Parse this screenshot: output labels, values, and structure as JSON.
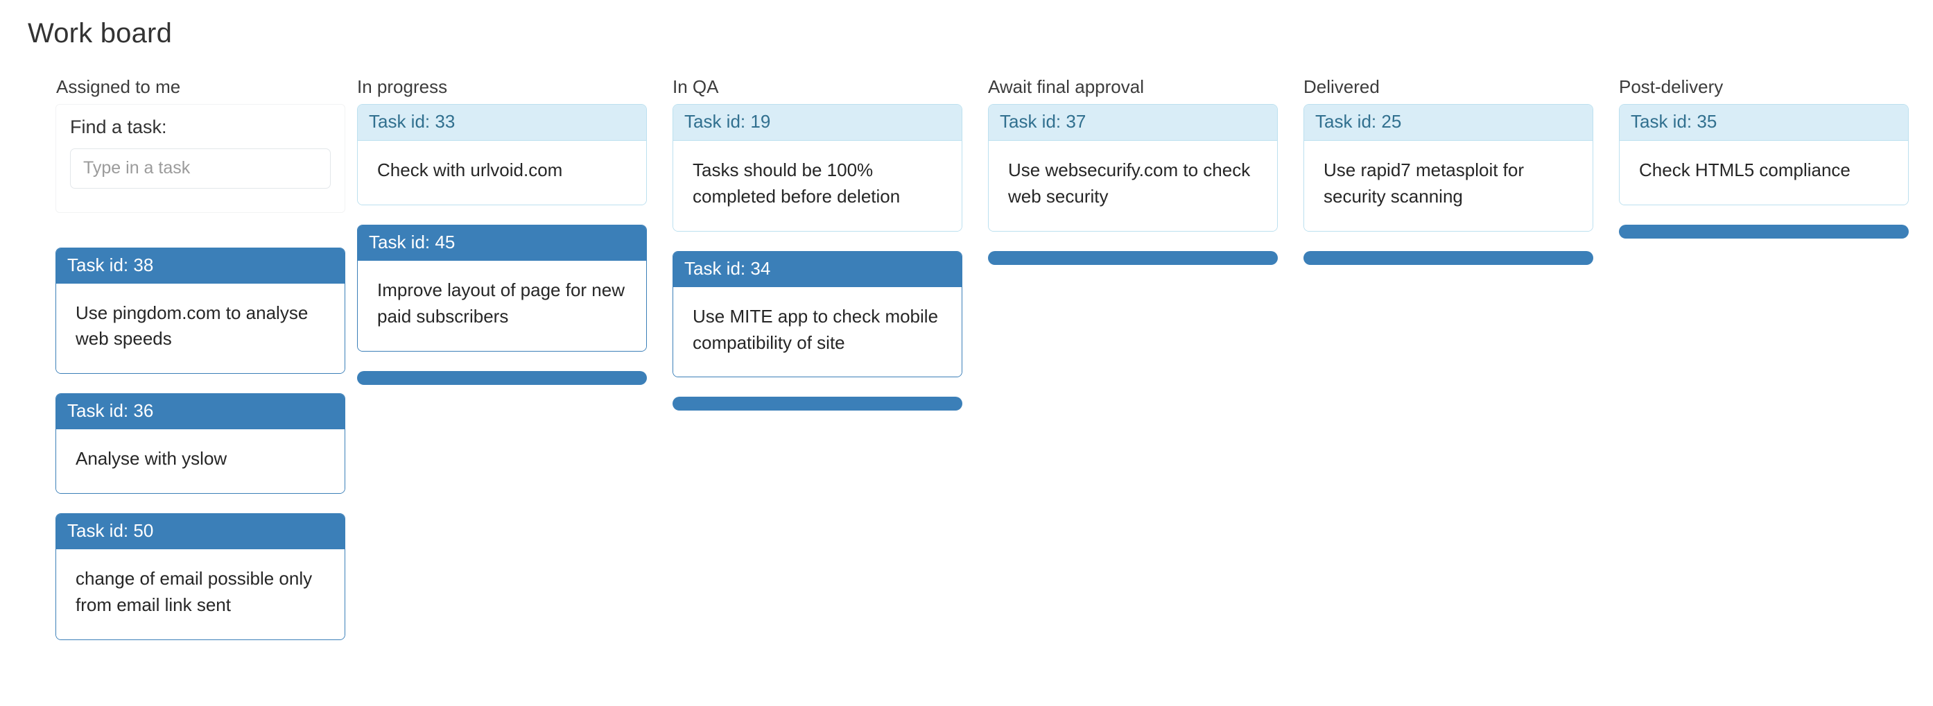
{
  "header": {
    "title": "Work board"
  },
  "search": {
    "label": "Find a task:",
    "placeholder": "Type in a task",
    "value": ""
  },
  "columns": [
    {
      "id": "assigned-to-me",
      "title": "Assigned to me",
      "has_search": true,
      "has_drop_bar": false,
      "cards": [
        {
          "id_label": "Task id: 38",
          "text": "Use pingdom.com to analyse web speeds",
          "style": "primary"
        },
        {
          "id_label": "Task id: 36",
          "text": "Analyse with yslow",
          "style": "primary"
        },
        {
          "id_label": "Task id: 50",
          "text": "change of email possible only from email link sent",
          "style": "primary"
        }
      ]
    },
    {
      "id": "in-progress",
      "title": "In progress",
      "has_search": false,
      "has_drop_bar": true,
      "cards": [
        {
          "id_label": "Task id: 33",
          "text": "Check with urlvoid.com",
          "style": "info"
        },
        {
          "id_label": "Task id: 45",
          "text": "Improve layout of page for new paid subscribers",
          "style": "primary"
        }
      ]
    },
    {
      "id": "in-qa",
      "title": "In QA",
      "has_search": false,
      "has_drop_bar": true,
      "cards": [
        {
          "id_label": "Task id: 19",
          "text": "Tasks should be 100% completed before deletion",
          "style": "info"
        },
        {
          "id_label": "Task id: 34",
          "text": "Use MITE app to check mobile compatibility of site",
          "style": "primary"
        }
      ]
    },
    {
      "id": "await-final-approval",
      "title": "Await final approval",
      "has_search": false,
      "has_drop_bar": true,
      "cards": [
        {
          "id_label": "Task id: 37",
          "text": "Use websecurify.com to check web security",
          "style": "info"
        }
      ]
    },
    {
      "id": "delivered",
      "title": "Delivered",
      "has_search": false,
      "has_drop_bar": true,
      "cards": [
        {
          "id_label": "Task id: 25",
          "text": "Use rapid7 metasploit for security scanning",
          "style": "info"
        }
      ]
    },
    {
      "id": "post-delivery",
      "title": "Post-delivery",
      "has_search": false,
      "has_drop_bar": true,
      "cards": [
        {
          "id_label": "Task id: 35",
          "text": "Check HTML5 compliance",
          "style": "info"
        }
      ]
    }
  ],
  "colors": {
    "primary_blue": "#3b7fb8",
    "info_bg": "#d9edf7",
    "info_text": "#31708f",
    "info_border": "#bce0ef",
    "page_bg": "#ffffff",
    "text": "#333333"
  }
}
